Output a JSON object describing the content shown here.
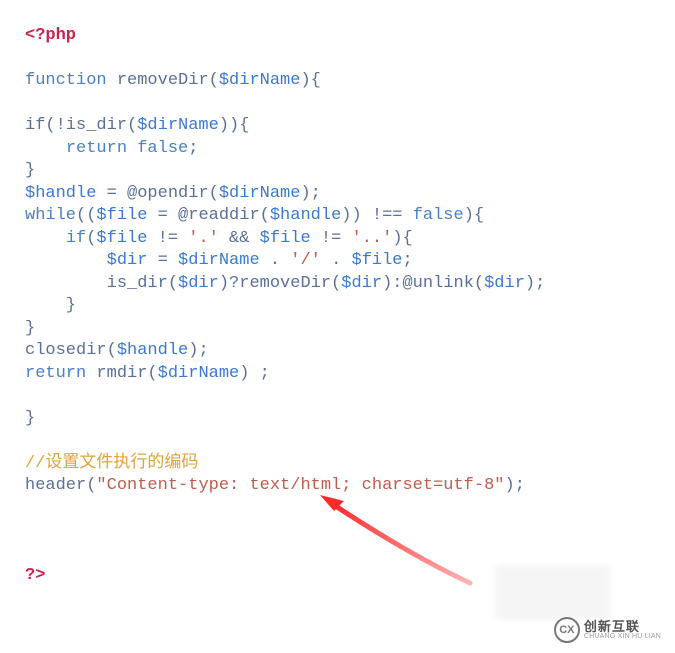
{
  "code": {
    "l1": "<?php",
    "l2a": "function",
    "l2b": " removeDir(",
    "l2c": "$dirName",
    "l2d": "){",
    "l3a": "if(!is_dir(",
    "l3b": "$dirName",
    "l3c": ")){",
    "l4a": "    ",
    "l4b": "return false",
    "l4c": ";",
    "l5": "}",
    "l6a": "$handle",
    "l6b": " = @opendir(",
    "l6c": "$dirName",
    "l6d": ");",
    "l7a": "while",
    "l7b": "((",
    "l7c": "$file",
    "l7d": " = @readdir(",
    "l7e": "$handle",
    "l7f": ")) !== ",
    "l7g": "false",
    "l7h": "){",
    "l8a": "    ",
    "l8b": "if",
    "l8c": "(",
    "l8d": "$file",
    "l8e": " != ",
    "l8f": "'.'",
    "l8g": " && ",
    "l8h": "$file",
    "l8i": " != ",
    "l8j": "'..'",
    "l8k": "){",
    "l9a": "        ",
    "l9b": "$dir",
    "l9c": " = ",
    "l9d": "$dirName",
    "l9e": " . ",
    "l9f": "'/'",
    "l9g": " . ",
    "l9h": "$file",
    "l9i": ";",
    "l10a": "        is_dir(",
    "l10b": "$dir",
    "l10c": ")?removeDir(",
    "l10d": "$dir",
    "l10e": "):@unlink(",
    "l10f": "$dir",
    "l10g": ");",
    "l11": "    }",
    "l12": "}",
    "l13a": "closedir(",
    "l13b": "$handle",
    "l13c": ");",
    "l14a": "return",
    "l14b": " rmdir(",
    "l14c": "$dirName",
    "l14d": ") ;",
    "l15": "}",
    "comment": "//设置文件执行的编码",
    "l16a": "header(",
    "l16b": "\"Content-type: text/html; charset=utf-8\"",
    "l16c": ");",
    "l17": "?>"
  },
  "logo": {
    "mark": "CX",
    "cn": "创新互联",
    "en": "CHUANG XIN HU LIAN"
  }
}
